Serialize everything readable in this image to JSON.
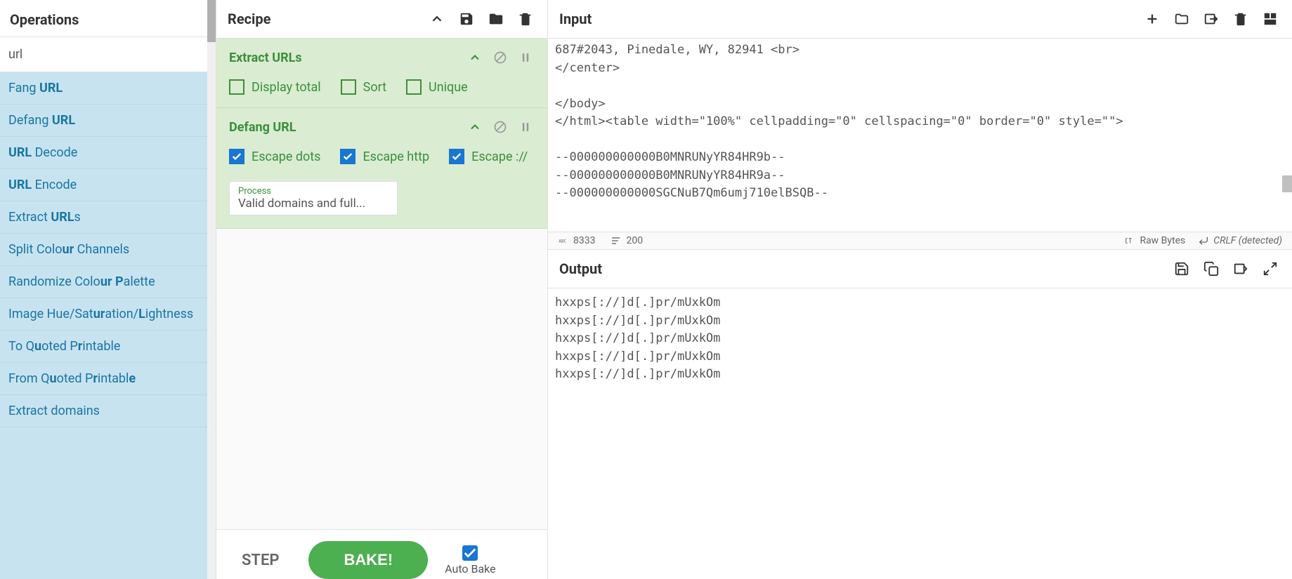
{
  "operations": {
    "title": "Operations",
    "search_value": "url",
    "list": [
      {
        "pre": "Fang ",
        "bold": "URL",
        "post": ""
      },
      {
        "pre": "Defang ",
        "bold": "URL",
        "post": ""
      },
      {
        "pre": "",
        "bold": "URL",
        "post": " Decode"
      },
      {
        "pre": "",
        "bold": "URL",
        "post": " Encode"
      },
      {
        "pre": "Extract ",
        "bold": "URL",
        "post": "s"
      },
      {
        "pre": "Split Colo",
        "bold": "ur",
        "post": " Channels"
      },
      {
        "pre": "Randomize Colo",
        "bold": "ur P",
        "post": "alette"
      },
      {
        "pre": "Image Hue/Sat",
        "bold": "ur",
        "post": "ation/",
        "bold2": "L",
        "post2": "ightness"
      },
      {
        "pre": "To Q",
        "bold": "u",
        "post": "oted P",
        "bold2": "r",
        "post2": "intable"
      },
      {
        "pre": "From Q",
        "bold": "u",
        "post": "oted P",
        "bold2": "r",
        "post2": "intabl",
        "bold3": "e",
        "post3": ""
      },
      {
        "pre": "Extract domains",
        "bold": "",
        "post": ""
      }
    ]
  },
  "recipe": {
    "title": "Recipe",
    "ops": [
      {
        "name": "Extract URLs",
        "args_check": [
          {
            "label": "Display total",
            "checked": false
          },
          {
            "label": "Sort",
            "checked": false
          },
          {
            "label": "Unique",
            "checked": false
          }
        ]
      },
      {
        "name": "Defang URL",
        "args_check": [
          {
            "label": "Escape dots",
            "checked": true
          },
          {
            "label": "Escape http",
            "checked": true
          },
          {
            "label": "Escape ://",
            "checked": true
          }
        ],
        "select": {
          "label": "Process",
          "value": "Valid domains and full..."
        }
      }
    ],
    "step": "STEP",
    "bake": "BAKE!",
    "auto_bake": "Auto Bake"
  },
  "input": {
    "title": "Input",
    "text": "687#2043, Pinedale, WY, 82941 <br>\n</center>\n\n</body>\n</html><table width=\"100%\" cellpadding=\"0\" cellspacing=\"0\" border=\"0\" style=\"\">\n\n--000000000000B0MNRUNyYR84HR9b--\n--000000000000B0MNRUNyYR84HR9a--\n--000000000000SGCNuB7Qm6umj710elBSQB--\n",
    "status": {
      "chars": "8333",
      "lines": "200",
      "encoding": "Raw Bytes",
      "eol": "CRLF (detected)"
    }
  },
  "output": {
    "title": "Output",
    "text": "hxxps[://]d[.]pr/mUxkOm\nhxxps[://]d[.]pr/mUxkOm\nhxxps[://]d[.]pr/mUxkOm\nhxxps[://]d[.]pr/mUxkOm\nhxxps[://]d[.]pr/mUxkOm"
  }
}
